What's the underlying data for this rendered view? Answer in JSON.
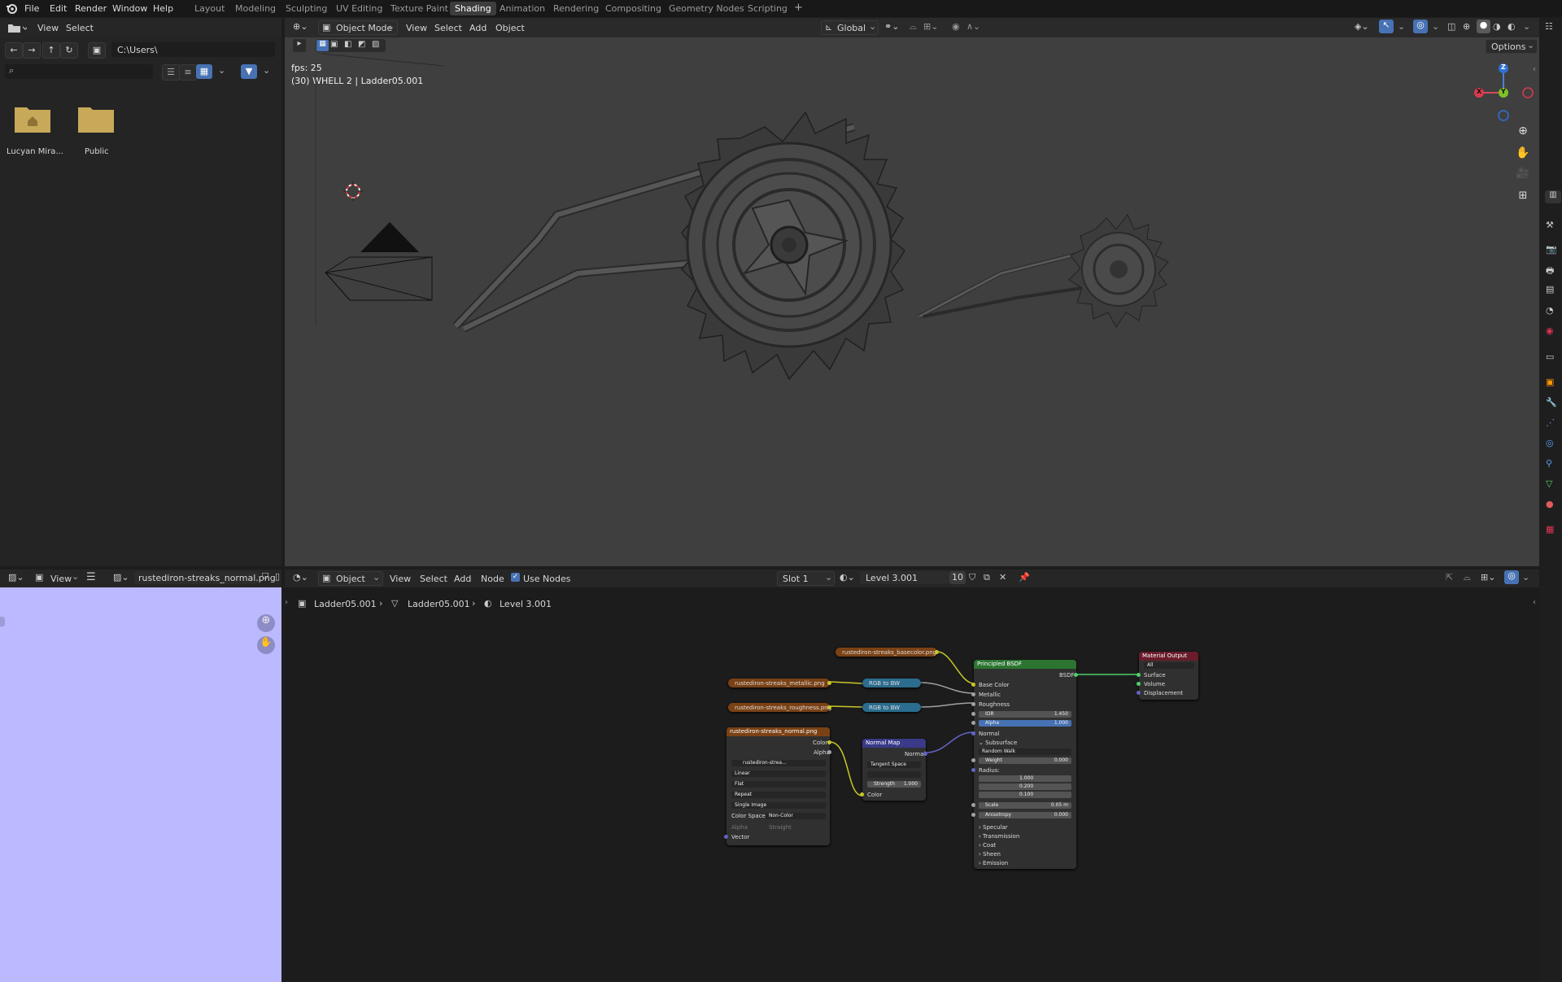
{
  "menus": [
    "File",
    "Edit",
    "Render",
    "Window",
    "Help"
  ],
  "workspaces": [
    "Layout",
    "Modeling",
    "Sculpting",
    "UV Editing",
    "Texture Paint",
    "Shading",
    "Animation",
    "Rendering",
    "Compositing",
    "Geometry Nodes",
    "Scripting"
  ],
  "active_workspace": "Shading",
  "file_browser": {
    "menu": [
      "View",
      "Select"
    ],
    "path": "C:\\Users\\",
    "items": [
      {
        "label": "Lucyan Mira..."
      },
      {
        "label": "Public"
      }
    ]
  },
  "viewport": {
    "mode": "Object Mode",
    "menu": [
      "View",
      "Select",
      "Add",
      "Object"
    ],
    "orientation": "Global",
    "options": "Options",
    "fps": "fps: 25",
    "object_info": "(30) WHELL 2 | Ladder05.001",
    "gizmo": {
      "x": "X",
      "y": "Y",
      "z": "Z"
    }
  },
  "image_editor": {
    "view": "View",
    "image_name": "rustediron-streaks_normal.png"
  },
  "node_editor": {
    "object": "Object",
    "menu": [
      "View",
      "Select",
      "Add",
      "Node"
    ],
    "use_nodes": "Use Nodes",
    "slot": "Slot 1",
    "material": "Level 3.001",
    "users": "10",
    "breadcrumb": [
      "Ladder05.001",
      "Ladder05.001",
      "Level 3.001"
    ],
    "nodes": {
      "basecolor": "rustediron-streaks_basecolor.png",
      "metallic": "rustediron-streaks_metallic.png",
      "roughness": "rustediron-streaks_roughness.png",
      "normal_tex": {
        "title": "rustediron-streaks_normal.png",
        "image": "rustediron-strea...",
        "outputs": [
          "Color",
          "Alpha"
        ],
        "interp": "Linear",
        "proj": "Flat",
        "ext": "Repeat",
        "source": "Single Image",
        "cs_label": "Color Space",
        "cs_value": "Non-Color",
        "alpha_label": "Alpha",
        "alpha_value": "Straight",
        "vector": "Vector"
      },
      "rgb1": "RGB to BW",
      "rgb2": "RGB to BW",
      "normal_map": {
        "title": "Normal Map",
        "out": "Normal",
        "space": "Tangent Space",
        "strength_label": "Strength",
        "strength": "1.000",
        "color": "Color"
      },
      "bsdf": {
        "title": "Principled BSDF",
        "out": "BSDF",
        "inputs": [
          "Base Color",
          "Metallic",
          "Roughness"
        ],
        "ior_label": "IOR",
        "ior": "1.450",
        "alpha_label": "Alpha",
        "alpha": "1.000",
        "normal": "Normal",
        "subsurface": "Subsurface",
        "method": "Random Walk",
        "weight_label": "Weight",
        "weight": "0.000",
        "radius": "Radius:",
        "r1": "1.000",
        "r2": "0.200",
        "r3": "0.100",
        "scale_label": "Scale",
        "scale": "0.05 m",
        "aniso_label": "Anisotropy",
        "aniso": "0.000",
        "panels": [
          "Specular",
          "Transmission",
          "Coat",
          "Sheen",
          "Emission"
        ]
      },
      "output": {
        "title": "Material Output",
        "target": "All",
        "inputs": [
          "Surface",
          "Volume",
          "Displacement"
        ]
      }
    }
  }
}
